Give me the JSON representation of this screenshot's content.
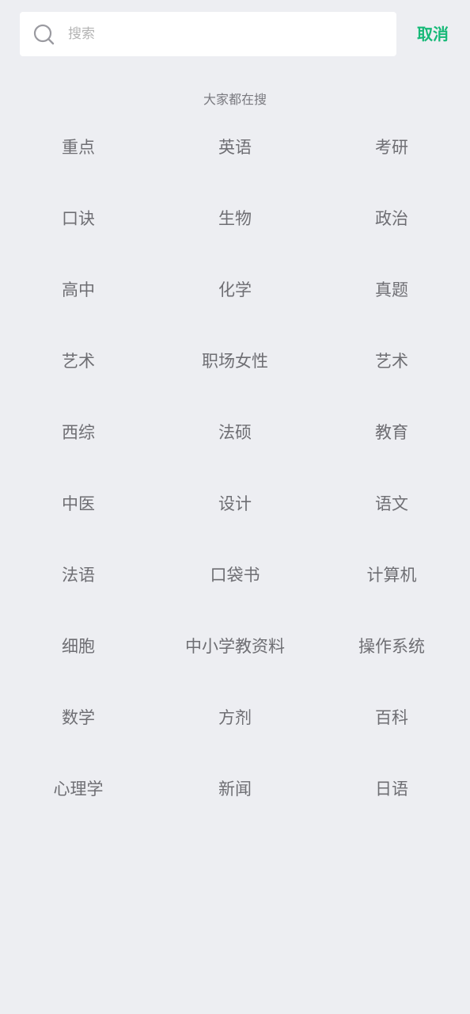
{
  "search": {
    "placeholder": "搜索",
    "value": "",
    "cancel_label": "取消"
  },
  "hot": {
    "title": "大家都在搜",
    "tags": [
      "重点",
      "英语",
      "考研",
      "口诀",
      "生物",
      "政治",
      "高中",
      "化学",
      "真题",
      "艺术",
      "职场女性",
      "艺术",
      "西综",
      "法硕",
      "教育",
      "中医",
      "设计",
      "语文",
      "法语",
      "口袋书",
      "计算机",
      "细胞",
      "中小学教资料",
      "操作系统",
      "数学",
      "方剂",
      "百科",
      "心理学",
      "新闻",
      "日语"
    ]
  },
  "colors": {
    "background": "#EDEEF2",
    "accent": "#17B978",
    "tag_text": "#6E6E73"
  },
  "icons": {
    "search": "search-icon"
  }
}
